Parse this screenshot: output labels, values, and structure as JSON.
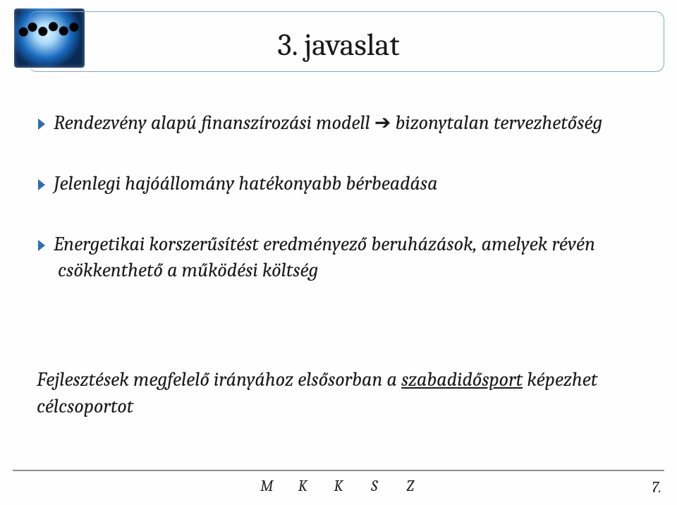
{
  "title": "3. javaslat",
  "bullets": [
    {
      "prefix": "Rendezvény alapú finanszírozási modell ",
      "arrow": "➔",
      "suffix": " bizonytalan tervezhetőség"
    },
    {
      "prefix": "Jelenlegi hajóállomány hatékonyabb bérbeadása",
      "arrow": "",
      "suffix": ""
    },
    {
      "prefix": "Energetikai korszerűsítést eredményező beruházások, amelyek révén csökkenthető a működési költség",
      "arrow": "",
      "suffix": ""
    }
  ],
  "conclusion": {
    "lead": "Fejlesztések megfelelő irányához elsősorban a ",
    "underlined": "szabadidősport",
    "tail": " képezhet célcsoportot"
  },
  "footer": {
    "letters": [
      "M",
      "K",
      "K",
      "S",
      "Z"
    ],
    "page": "7."
  },
  "colors": {
    "chevron": "#2f6fb3",
    "rule": "#8d8d8d",
    "frame": "#87a8c0"
  }
}
